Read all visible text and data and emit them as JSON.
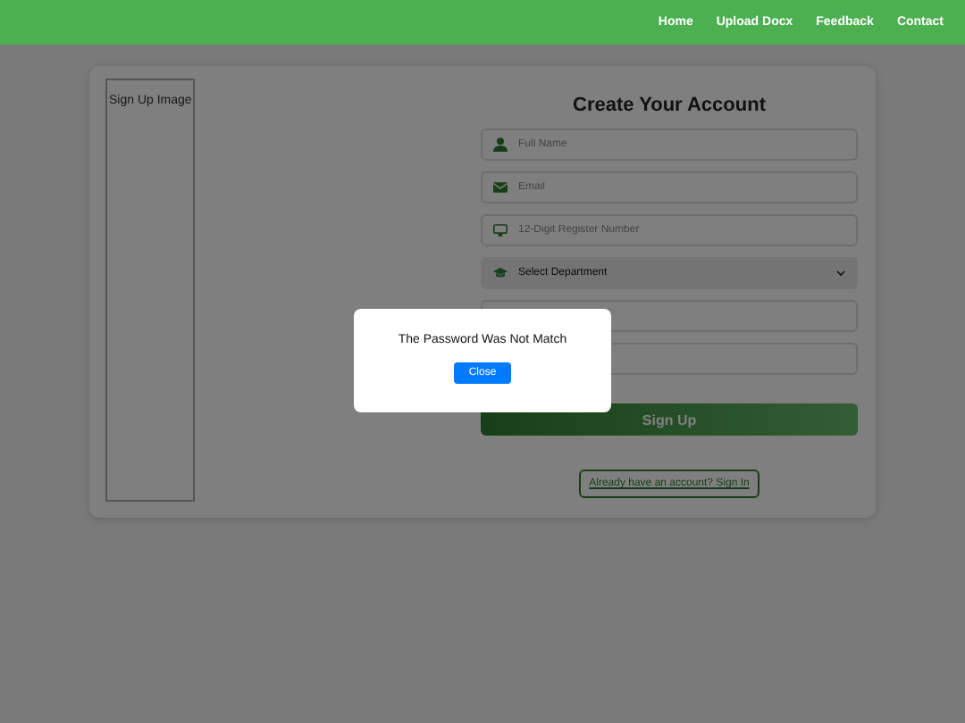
{
  "navbar": {
    "links": [
      "Home",
      "Upload Docx",
      "Feedback",
      "Contact"
    ]
  },
  "image_alt": "Sign Up Image",
  "form": {
    "title": "Create Your Account",
    "fields": [
      {
        "kind": "name",
        "placeholder": "Full Name"
      },
      {
        "kind": "email",
        "placeholder": "Email"
      },
      {
        "kind": "register",
        "placeholder": "12-Digit Register Number"
      },
      {
        "kind": "select",
        "value": "Select Department"
      },
      {
        "kind": "password"
      },
      {
        "kind": "password"
      }
    ],
    "submit": "Sign Up",
    "signin_link": "Already have an account? Sign In"
  },
  "modal": {
    "message": "The Password Was Not Match",
    "button": "Close"
  }
}
